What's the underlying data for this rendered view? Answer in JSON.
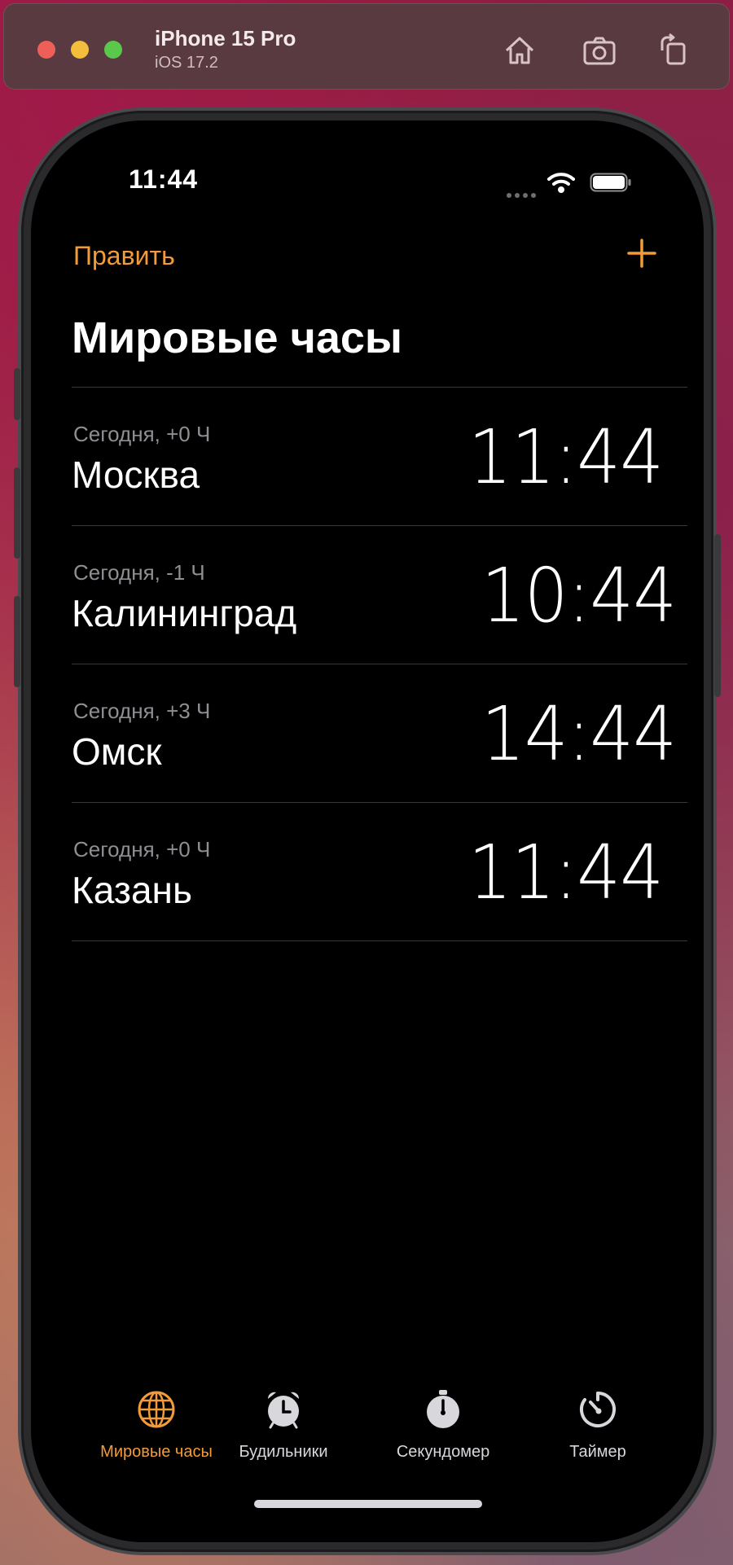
{
  "simulator": {
    "device": "iPhone 15 Pro",
    "os": "iOS 17.2",
    "buttons": [
      "home-icon",
      "screenshot-icon",
      "rotate-icon"
    ]
  },
  "status_bar": {
    "time": "11:44"
  },
  "nav": {
    "edit_label": "Править",
    "add_icon": "plus-icon",
    "title": "Мировые часы"
  },
  "clocks": [
    {
      "offset": "Сегодня, +0  Ч",
      "city": "Москва",
      "time": "11:44"
    },
    {
      "offset": "Сегодня, -1  Ч",
      "city": "Калининград",
      "time": "10:44"
    },
    {
      "offset": "Сегодня, +3 Ч",
      "city": "Омск",
      "time": "14:44"
    },
    {
      "offset": "Сегодня, +0  Ч",
      "city": "Казань",
      "time": "11:44"
    }
  ],
  "tabs": [
    {
      "label": "Мировые часы",
      "icon": "globe-icon",
      "active": true
    },
    {
      "label": "Будильники",
      "icon": "alarm-icon",
      "active": false
    },
    {
      "label": "Секундомер",
      "icon": "stopwatch-icon",
      "active": false
    },
    {
      "label": "Таймер",
      "icon": "timer-icon",
      "active": false
    }
  ],
  "colors": {
    "accent": "#f39b38",
    "background": "#000000",
    "text": "#ffffff",
    "secondary": "#8e8e93"
  }
}
